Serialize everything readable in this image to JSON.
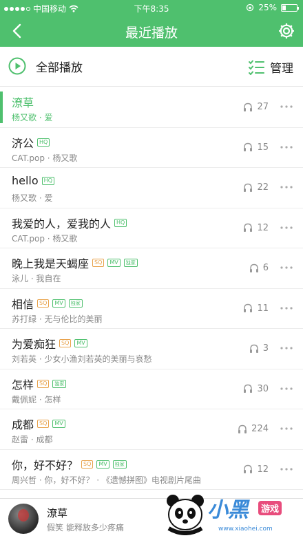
{
  "status_bar": {
    "carrier": "中国移动",
    "time": "下午8:35",
    "battery": "25%",
    "battery_level": 0.25
  },
  "nav": {
    "title": "最近播放"
  },
  "toolbar": {
    "play_all_label": "全部播放",
    "manage_label": "管理"
  },
  "colors": {
    "accent": "#4fc06e",
    "sq_badge": "#e8a24a"
  },
  "songs": [
    {
      "title": "潦草",
      "subtitle": "杨又歌 · 爱",
      "plays": "27",
      "badges": [],
      "active": true
    },
    {
      "title": "济公",
      "subtitle": "CAT.pop · 杨又歌",
      "plays": "15",
      "badges": [
        "HQ"
      ]
    },
    {
      "title": "hello",
      "subtitle": "杨又歌 · 爱",
      "plays": "22",
      "badges": [
        "HQ"
      ]
    },
    {
      "title": "我爱的人，爱我的人",
      "subtitle": "CAT.pop · 杨又歌",
      "plays": "12",
      "badges": [
        "HQ"
      ]
    },
    {
      "title": "晚上我是天蝎座",
      "subtitle": "泳儿 · 我自在",
      "plays": "6",
      "badges": [
        "SQ",
        "MV",
        "独家"
      ]
    },
    {
      "title": "相信",
      "subtitle": "苏打绿 · 无与伦比的美丽",
      "plays": "11",
      "badges": [
        "SQ",
        "MV",
        "独家"
      ]
    },
    {
      "title": "为爱痴狂",
      "subtitle": "刘若英 · 少女小渔刘若英的美丽与哀愁",
      "plays": "3",
      "badges": [
        "SQ",
        "MV"
      ]
    },
    {
      "title": "怎样",
      "subtitle": "戴佩妮 · 怎样",
      "plays": "30",
      "badges": [
        "SQ",
        "独家"
      ]
    },
    {
      "title": "成都",
      "subtitle": "赵雷 · 成都",
      "plays": "224",
      "badges": [
        "SQ",
        "MV"
      ]
    },
    {
      "title": "你，好不好？",
      "subtitle": "周兴哲 · 你，好不好？ · 《遗憾拼图》电视剧片尾曲",
      "plays": "12",
      "badges": [
        "SQ",
        "MV",
        "独家"
      ]
    }
  ],
  "player": {
    "title": "潦草",
    "subtitle": "假笑 能释放多少疼痛"
  },
  "watermark": {
    "brand": "小黑",
    "brand2": "游戏",
    "url": "www.xiaohei.com"
  }
}
